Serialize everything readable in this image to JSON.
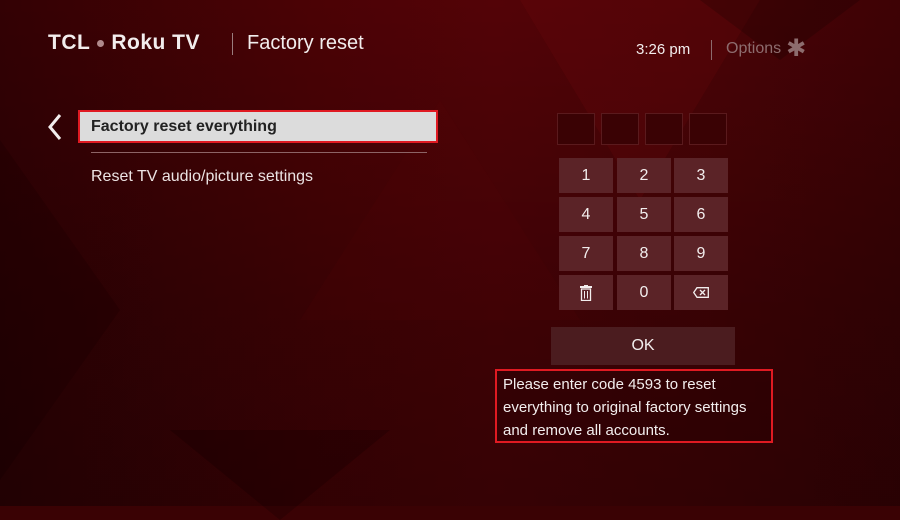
{
  "header": {
    "brand_left": "TCL",
    "brand_right": "Roku TV",
    "title": "Factory reset",
    "time": "3:26  pm",
    "options_label": "Options",
    "options_icon": "asterisk-icon"
  },
  "menu": {
    "back_icon": "chevron-left-icon",
    "items": [
      {
        "label": "Factory reset everything",
        "selected": true
      },
      {
        "label": "Reset TV audio/picture settings",
        "selected": false
      }
    ]
  },
  "keypad": {
    "code_entered": "",
    "code_slots": 4,
    "keys": [
      "1",
      "2",
      "3",
      "4",
      "5",
      "6",
      "7",
      "8",
      "9",
      "trash-icon",
      "0",
      "backspace-icon"
    ],
    "ok_label": "OK"
  },
  "message": "Please enter code 4593 to reset everything to original factory settings and remove all accounts.",
  "colors": {
    "highlight_border": "#e01a22",
    "background": "#4b0205",
    "key_bg": "#5b2327"
  }
}
